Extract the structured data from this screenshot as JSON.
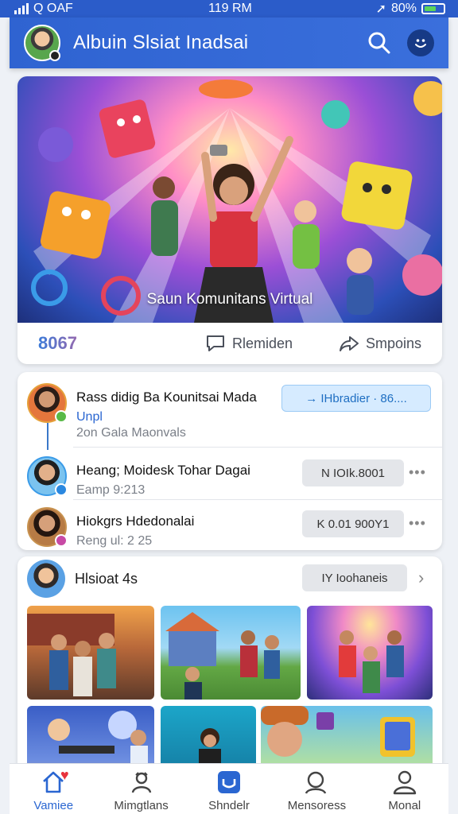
{
  "status_bar": {
    "carrier": "Q OAF",
    "time": "119 RM",
    "battery": "80%"
  },
  "header": {
    "title": "Albuin Slsiat Inadsai"
  },
  "hero": {
    "caption": "Saun Komunitans Virtual",
    "reaction_count": "8067",
    "comment_label": "Rlemiden",
    "share_label": "Smpoins"
  },
  "feed": {
    "items": [
      {
        "name": "Rass didig Ba Kounitsai Mada",
        "sub": "Unpl",
        "action": "→ IHbradier · 86...."
      },
      {
        "name": "",
        "sub": "2on Gala Maonvals",
        "action": ""
      },
      {
        "name": "Heang; Moidesk Tohar Dagai",
        "sub": "Eamp 9:213",
        "action": "N IOIk.8001"
      },
      {
        "name": "Hiokgrs Hdedonalai",
        "sub": "Reng ul: 2 25",
        "action": "K 0.01 900Y1"
      }
    ]
  },
  "album": {
    "title": "Hlsioat 4s",
    "action": "IY Ioohaneis"
  },
  "nav": {
    "items": [
      {
        "label": "Vamiee"
      },
      {
        "label": "Mimgtlans"
      },
      {
        "label": "Shndelr"
      },
      {
        "label": "Mensoress"
      },
      {
        "label": "Monal"
      }
    ]
  },
  "colors": {
    "primary": "#2f63d1",
    "accent_blue": "#d6ebff",
    "heart": "#e8323c"
  }
}
